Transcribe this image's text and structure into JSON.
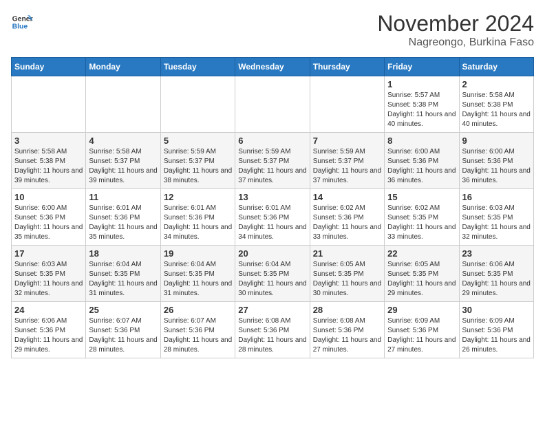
{
  "header": {
    "logo": {
      "line1": "General",
      "line2": "Blue"
    },
    "month": "November 2024",
    "location": "Nagreongo, Burkina Faso"
  },
  "days_of_week": [
    "Sunday",
    "Monday",
    "Tuesday",
    "Wednesday",
    "Thursday",
    "Friday",
    "Saturday"
  ],
  "weeks": [
    [
      {
        "day": "",
        "info": ""
      },
      {
        "day": "",
        "info": ""
      },
      {
        "day": "",
        "info": ""
      },
      {
        "day": "",
        "info": ""
      },
      {
        "day": "",
        "info": ""
      },
      {
        "day": "1",
        "info": "Sunrise: 5:57 AM\nSunset: 5:38 PM\nDaylight: 11 hours and 40 minutes."
      },
      {
        "day": "2",
        "info": "Sunrise: 5:58 AM\nSunset: 5:38 PM\nDaylight: 11 hours and 40 minutes."
      }
    ],
    [
      {
        "day": "3",
        "info": "Sunrise: 5:58 AM\nSunset: 5:38 PM\nDaylight: 11 hours and 39 minutes."
      },
      {
        "day": "4",
        "info": "Sunrise: 5:58 AM\nSunset: 5:37 PM\nDaylight: 11 hours and 39 minutes."
      },
      {
        "day": "5",
        "info": "Sunrise: 5:59 AM\nSunset: 5:37 PM\nDaylight: 11 hours and 38 minutes."
      },
      {
        "day": "6",
        "info": "Sunrise: 5:59 AM\nSunset: 5:37 PM\nDaylight: 11 hours and 37 minutes."
      },
      {
        "day": "7",
        "info": "Sunrise: 5:59 AM\nSunset: 5:37 PM\nDaylight: 11 hours and 37 minutes."
      },
      {
        "day": "8",
        "info": "Sunrise: 6:00 AM\nSunset: 5:36 PM\nDaylight: 11 hours and 36 minutes."
      },
      {
        "day": "9",
        "info": "Sunrise: 6:00 AM\nSunset: 5:36 PM\nDaylight: 11 hours and 36 minutes."
      }
    ],
    [
      {
        "day": "10",
        "info": "Sunrise: 6:00 AM\nSunset: 5:36 PM\nDaylight: 11 hours and 35 minutes."
      },
      {
        "day": "11",
        "info": "Sunrise: 6:01 AM\nSunset: 5:36 PM\nDaylight: 11 hours and 35 minutes."
      },
      {
        "day": "12",
        "info": "Sunrise: 6:01 AM\nSunset: 5:36 PM\nDaylight: 11 hours and 34 minutes."
      },
      {
        "day": "13",
        "info": "Sunrise: 6:01 AM\nSunset: 5:36 PM\nDaylight: 11 hours and 34 minutes."
      },
      {
        "day": "14",
        "info": "Sunrise: 6:02 AM\nSunset: 5:36 PM\nDaylight: 11 hours and 33 minutes."
      },
      {
        "day": "15",
        "info": "Sunrise: 6:02 AM\nSunset: 5:35 PM\nDaylight: 11 hours and 33 minutes."
      },
      {
        "day": "16",
        "info": "Sunrise: 6:03 AM\nSunset: 5:35 PM\nDaylight: 11 hours and 32 minutes."
      }
    ],
    [
      {
        "day": "17",
        "info": "Sunrise: 6:03 AM\nSunset: 5:35 PM\nDaylight: 11 hours and 32 minutes."
      },
      {
        "day": "18",
        "info": "Sunrise: 6:04 AM\nSunset: 5:35 PM\nDaylight: 11 hours and 31 minutes."
      },
      {
        "day": "19",
        "info": "Sunrise: 6:04 AM\nSunset: 5:35 PM\nDaylight: 11 hours and 31 minutes."
      },
      {
        "day": "20",
        "info": "Sunrise: 6:04 AM\nSunset: 5:35 PM\nDaylight: 11 hours and 30 minutes."
      },
      {
        "day": "21",
        "info": "Sunrise: 6:05 AM\nSunset: 5:35 PM\nDaylight: 11 hours and 30 minutes."
      },
      {
        "day": "22",
        "info": "Sunrise: 6:05 AM\nSunset: 5:35 PM\nDaylight: 11 hours and 29 minutes."
      },
      {
        "day": "23",
        "info": "Sunrise: 6:06 AM\nSunset: 5:35 PM\nDaylight: 11 hours and 29 minutes."
      }
    ],
    [
      {
        "day": "24",
        "info": "Sunrise: 6:06 AM\nSunset: 5:36 PM\nDaylight: 11 hours and 29 minutes."
      },
      {
        "day": "25",
        "info": "Sunrise: 6:07 AM\nSunset: 5:36 PM\nDaylight: 11 hours and 28 minutes."
      },
      {
        "day": "26",
        "info": "Sunrise: 6:07 AM\nSunset: 5:36 PM\nDaylight: 11 hours and 28 minutes."
      },
      {
        "day": "27",
        "info": "Sunrise: 6:08 AM\nSunset: 5:36 PM\nDaylight: 11 hours and 28 minutes."
      },
      {
        "day": "28",
        "info": "Sunrise: 6:08 AM\nSunset: 5:36 PM\nDaylight: 11 hours and 27 minutes."
      },
      {
        "day": "29",
        "info": "Sunrise: 6:09 AM\nSunset: 5:36 PM\nDaylight: 11 hours and 27 minutes."
      },
      {
        "day": "30",
        "info": "Sunrise: 6:09 AM\nSunset: 5:36 PM\nDaylight: 11 hours and 26 minutes."
      }
    ]
  ]
}
